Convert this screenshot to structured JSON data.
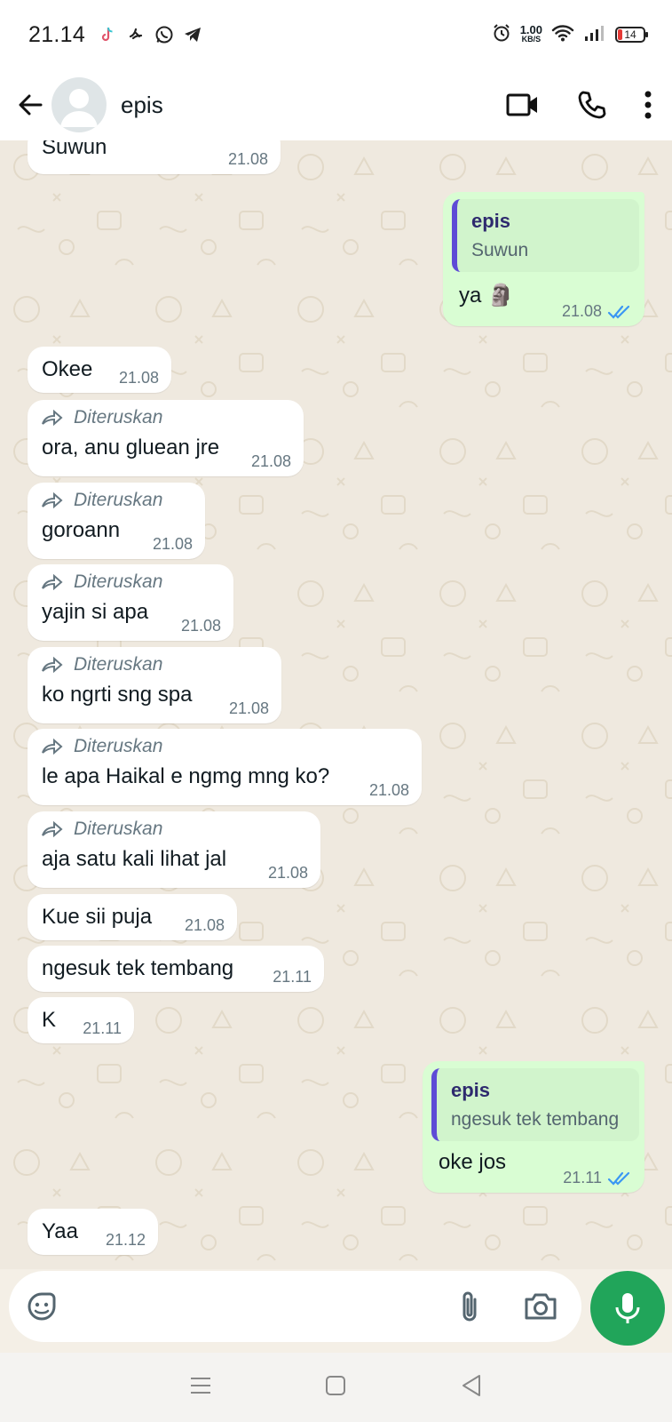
{
  "status_bar": {
    "time": "21.14",
    "app_icons": [
      "tiktok-icon",
      "app-icon",
      "whatsapp-icon",
      "telegram-icon"
    ],
    "net_speed_value": "1.00",
    "net_speed_unit": "KB/S",
    "battery": "14"
  },
  "header": {
    "contact_name": "epis"
  },
  "messages": [
    {
      "dir": "in",
      "text": "Suwun",
      "time": "21.08"
    },
    {
      "dir": "out",
      "quote_author": "epis",
      "quote_text": "Suwun",
      "text": "ya 🗿",
      "time": "21.08",
      "status": "read"
    },
    {
      "dir": "in",
      "text": "Okee",
      "time": "21.08"
    },
    {
      "dir": "in",
      "forwarded": "Diteruskan",
      "text": "ora, anu gluean jre",
      "time": "21.08"
    },
    {
      "dir": "in",
      "forwarded": "Diteruskan",
      "text": "goroann",
      "time": "21.08"
    },
    {
      "dir": "in",
      "forwarded": "Diteruskan",
      "text": "yajin si apa",
      "time": "21.08"
    },
    {
      "dir": "in",
      "forwarded": "Diteruskan",
      "text": "ko ngrti sng spa",
      "time": "21.08"
    },
    {
      "dir": "in",
      "forwarded": "Diteruskan",
      "text": "le apa Haikal e ngmg mng ko?",
      "time": "21.08"
    },
    {
      "dir": "in",
      "forwarded": "Diteruskan",
      "text": "aja satu kali lihat jal",
      "time": "21.08"
    },
    {
      "dir": "in",
      "text": "Kue sii puja",
      "time": "21.08"
    },
    {
      "dir": "in",
      "text": "ngesuk tek tembang",
      "time": "21.11"
    },
    {
      "dir": "in",
      "text": "K",
      "time": "21.11"
    },
    {
      "dir": "out",
      "quote_author": "epis",
      "quote_text": "ngesuk tek tembang",
      "text": "oke jos",
      "time": "21.11",
      "status": "read"
    },
    {
      "dir": "in",
      "text": "Yaa",
      "time": "21.12"
    }
  ],
  "composer": {
    "placeholder": ""
  },
  "colors": {
    "accent": "#21a55a",
    "outgoing_bubble": "#d9fdd3",
    "incoming_bubble": "#ffffff",
    "read_ticks": "#3b97f3",
    "chat_bg": "#efe9df"
  }
}
